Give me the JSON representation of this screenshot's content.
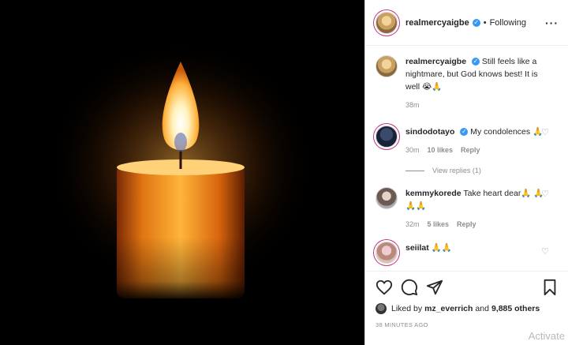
{
  "post": {
    "author": "realmercyaigbe",
    "follow_status": "Following",
    "more_icon": "more-options-icon",
    "caption": {
      "user": "realmercyaigbe",
      "text": "Still feels like a nightmare, but God knows best! It is well 😭🙏",
      "time": "38m"
    }
  },
  "comments": [
    {
      "user": "sindodotayo",
      "text": "My condolences 🙏",
      "time": "30m",
      "likes": "10 likes",
      "reply": "Reply",
      "view_replies": "View replies (1)"
    },
    {
      "user": "kemmykorede",
      "text": "Take heart dear🙏 🙏🙏🙏",
      "time": "32m",
      "likes": "5 likes",
      "reply": "Reply"
    },
    {
      "user": "seiilat",
      "text": "🙏🙏"
    }
  ],
  "actions": {
    "like_icon": "heart-icon",
    "comment_icon": "comment-icon",
    "share_icon": "share-icon",
    "save_icon": "bookmark-icon"
  },
  "likes": {
    "prefix": "Liked by ",
    "user": "mz_everrich",
    "middle": " and ",
    "others": "9,885 others"
  },
  "timestamp": "38 MINUTES AGO",
  "watermark": "Activate",
  "colors": {
    "verified": "#3897f0",
    "muted": "#8e8e8e",
    "border": "#dbdbdb"
  }
}
